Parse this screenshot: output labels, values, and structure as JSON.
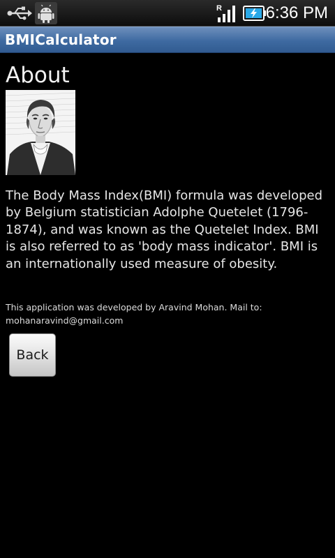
{
  "status_bar": {
    "time": "6:36 PM",
    "icons": [
      "usb-icon",
      "android-debug-icon",
      "roaming-signal-icon",
      "charging-battery-icon"
    ],
    "roaming_indicator": "R"
  },
  "app_bar": {
    "title": "BMICalculator"
  },
  "about": {
    "heading": "About",
    "portrait_icon": "adolphe-quetelet-portrait",
    "description": "The Body Mass Index(BMI) formula was developed by Belgium statistician Adolphe Quetelet (1796-1874), and was known as the Quetelet Index. BMI is also referred to as 'body mass indicator'. BMI is an internationally used measure of obesity.",
    "developer_note": "This application was developed by Aravind Mohan. Mail to: mohanaravind@gmail.com",
    "back_label": "Back"
  },
  "colors": {
    "background": "#000000",
    "title_bar": "#3e6aa1",
    "text": "#e6e6e6"
  }
}
